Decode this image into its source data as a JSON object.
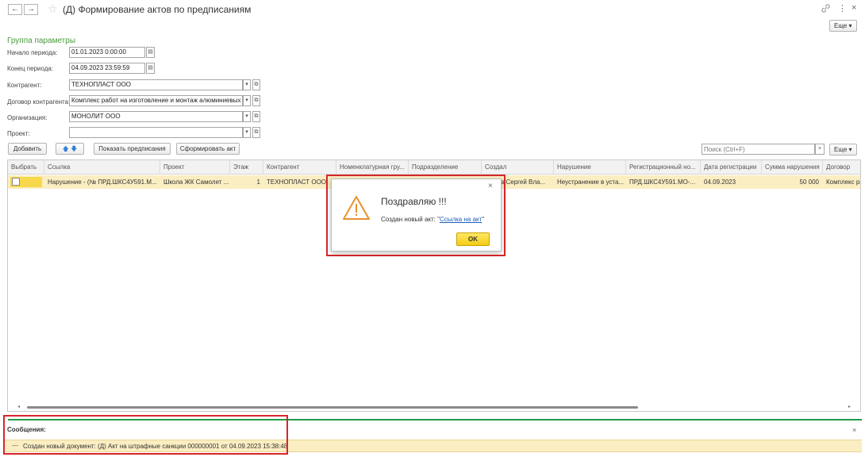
{
  "window": {
    "title": "(Д) Формирование актов по предписаниям",
    "back_symbol": "←",
    "forward_symbol": "→",
    "more_label": "Еще ▾",
    "link_symbol": "🔗",
    "menu_symbol": "⋮",
    "close_symbol": "×"
  },
  "params": {
    "group_title": "Группа параметры",
    "period_start_label": "Начало периода:",
    "period_start_value": "01.01.2023  0:00:00",
    "period_end_label": "Конец периода:",
    "period_end_value": "04.09.2023 23:59:59",
    "counterparty_label": "Контрагент:",
    "counterparty_value": "ТЕХНОПЛАСТ ООО",
    "contract_label": "Договор контрагента:",
    "contract_value": "Комплекс  работ на изготовление и монтаж алюминиевых в",
    "organization_label": "Организация:",
    "organization_value": "МОНОЛИТ ООО",
    "project_label": "Проект:",
    "project_value": ""
  },
  "toolbar": {
    "add_label": "Добавить",
    "show_prescriptions_label": "Показать предписания",
    "form_act_label": "Сформировать акт",
    "search_placeholder": "Поиск (Ctrl+F)",
    "clear_symbol": "×",
    "more_label": "Еще ▾"
  },
  "table": {
    "columns": [
      "Выбрать",
      "Ссылка",
      "Проект",
      "Этаж",
      "Контрагент",
      "Номенклатурная гру...",
      "Подразделение",
      "Создал",
      "Нарушение",
      "Регистрационный но...",
      "Дата регистрации",
      "Сумма нарушения",
      "Договор"
    ],
    "row": {
      "link": "Нарушение - (№ ПРД.ШКС4У591.М...",
      "project": "Школа ЖК Самолет ...",
      "floor": "1",
      "counterparty": "ТЕХНОПЛАСТ ООО",
      "created_by": "в Сергей Вла...",
      "violation": "Неустранение в уста...",
      "reg_number": "ПРД.ШКС4У591.МО-...",
      "reg_date": "04.09.2023",
      "amount": "50 000",
      "contract": "Комплекс  ра"
    }
  },
  "dialog": {
    "close_symbol": "×",
    "title": "Поздравляю !!!",
    "text_prefix": "Создан новый акт: \"",
    "link_text": "Ссылка на акт",
    "text_suffix": "\"",
    "ok_label": "OK"
  },
  "messages": {
    "title": "Сообщения:",
    "close_symbol": "×",
    "dash": "—",
    "text": "Создан новый документ: (Д) Акт на штрафные санкции 000000001 от 04.09.2023 15:38:48"
  },
  "colors": {
    "accent_green": "#4a9a3b",
    "highlight_red": "#d7262b",
    "row_yellow": "#fbeec2",
    "ok_yellow": "#f7d51b"
  }
}
